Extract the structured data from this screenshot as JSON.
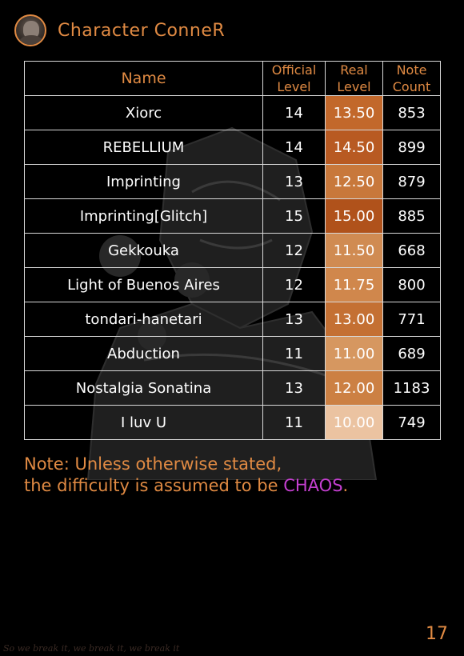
{
  "header": {
    "title": "Character ConneR"
  },
  "table": {
    "headers": {
      "name": "Name",
      "official_level": [
        "Official",
        "Level"
      ],
      "real_level": [
        "Real",
        "Level"
      ],
      "note_count": [
        "Note",
        "Count"
      ]
    },
    "rows": [
      {
        "name": "Xiorc",
        "official": "14",
        "real": "13.50",
        "notes": "853",
        "real_shade": "#c2682b"
      },
      {
        "name": "REBELLIUM",
        "official": "14",
        "real": "14.50",
        "notes": "899",
        "real_shade": "#b85a22"
      },
      {
        "name": "Imprinting",
        "official": "13",
        "real": "12.50",
        "notes": "879",
        "real_shade": "#c8783b"
      },
      {
        "name": "Imprinting[Glitch]",
        "official": "15",
        "real": "15.00",
        "notes": "885",
        "real_shade": "#b0521b",
        "glitch": true
      },
      {
        "name": "Gekkouka",
        "official": "12",
        "real": "11.50",
        "notes": "668",
        "real_shade": "#d08b52"
      },
      {
        "name": "Light of Buenos Aires",
        "official": "12",
        "real": "11.75",
        "notes": "800",
        "real_shade": "#d0874c"
      },
      {
        "name": "tondari-hanetari",
        "official": "13",
        "real": "13.00",
        "notes": "771",
        "real_shade": "#c47033"
      },
      {
        "name": "Abduction",
        "official": "11",
        "real": "11.00",
        "notes": "689",
        "real_shade": "#d69760"
      },
      {
        "name": "Nostalgia Sonatina",
        "official": "13",
        "real": "12.00",
        "notes": "1183",
        "real_shade": "#cc8043"
      },
      {
        "name": "I luv U",
        "official": "11",
        "real": "10.00",
        "notes": "749",
        "real_shade": "#ebc3a1"
      }
    ]
  },
  "note": {
    "line1": "Note: Unless otherwise stated,",
    "line2_prefix": "the difficulty is assumed to be ",
    "chaos": "CHAOS",
    "line2_suffix": "."
  },
  "footer": {
    "page_number": "17",
    "watermark": "So we break it, we break it, we break it"
  },
  "colors": {
    "accent": "#e08a43",
    "glitch_name": "#3fbf7f",
    "chaos": "#c43fd0"
  }
}
